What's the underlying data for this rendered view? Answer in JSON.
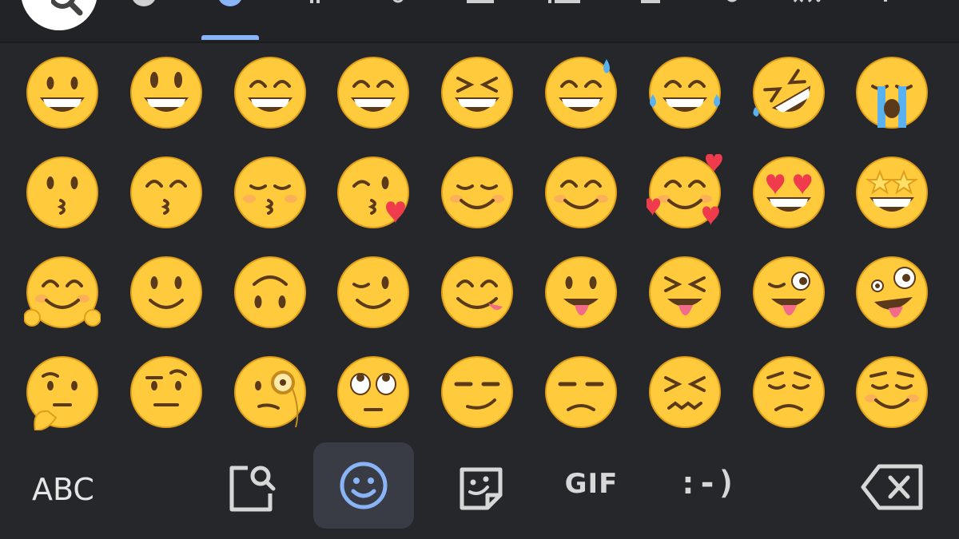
{
  "categories": [
    {
      "name": "search",
      "icon": "search-icon"
    },
    {
      "name": "recent",
      "icon": "clock-icon"
    },
    {
      "name": "smileys",
      "icon": "smiley-icon",
      "selected": true
    },
    {
      "name": "people",
      "icon": "person-icon"
    },
    {
      "name": "animals",
      "icon": "paw-icon"
    },
    {
      "name": "food",
      "icon": "food-icon"
    },
    {
      "name": "travel",
      "icon": "building-icon"
    },
    {
      "name": "activities",
      "icon": "trophy-icon"
    },
    {
      "name": "objects",
      "icon": "bulb-icon"
    },
    {
      "name": "symbols",
      "icon": "symbols-icon"
    },
    {
      "name": "flags",
      "icon": "flag-icon"
    }
  ],
  "emoji_rows": [
    [
      "grinning-face",
      "grinning-face-big-eyes",
      "grinning-face-smiling-eyes",
      "beaming-face",
      "grinning-squinting-face",
      "grinning-face-sweat",
      "face-tears-of-joy",
      "rolling-on-floor-laughing",
      "loudly-crying-face"
    ],
    [
      "kissing-face",
      "kissing-face-smiling-eyes",
      "kissing-face-closed-eyes",
      "face-blowing-kiss",
      "smiling-face",
      "smiling-face-smiling-eyes",
      "smiling-face-hearts",
      "heart-eyes",
      "star-struck"
    ],
    [
      "hugging-face",
      "slightly-smiling-face",
      "upside-down-face",
      "winking-face",
      "face-savoring-food",
      "face-with-tongue",
      "squinting-face-tongue",
      "winking-face-tongue",
      "zany-face"
    ],
    [
      "thinking-face",
      "face-raised-eyebrow",
      "face-with-monocle",
      "face-rolling-eyes",
      "smirking-face",
      "unamused-face",
      "confounded-face",
      "pensive-face",
      "relieved-face"
    ]
  ],
  "bottom_bar": {
    "abc_label": "ABC",
    "search_emoji_icon": "emoji-search-icon",
    "emoji_icon": "smiley-icon",
    "sticker_icon": "sticker-icon",
    "gif_label": "GIF",
    "emoticon_label": ":-)",
    "backspace_icon": "backspace-icon"
  },
  "colors": {
    "background": "#26272b",
    "accent": "#8ab4f8",
    "emoji_yellow": "#ffcb3d",
    "emoji_outline": "#e09f1a",
    "icon_gray": "#d7d7d7"
  }
}
